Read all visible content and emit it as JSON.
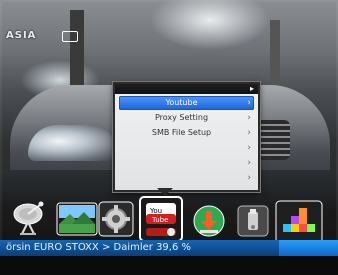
{
  "overlay": {
    "channel_tag": "ASIA"
  },
  "menu": {
    "top_arrow": "▸",
    "items": [
      {
        "label": "Youtube",
        "selected": true,
        "chevron": "›"
      },
      {
        "label": "Proxy Setting",
        "selected": false,
        "chevron": "›"
      },
      {
        "label": "SMB File Setup",
        "selected": false,
        "chevron": "›"
      },
      {
        "label": "",
        "selected": false,
        "chevron": "›"
      },
      {
        "label": "",
        "selected": false,
        "chevron": "›"
      },
      {
        "label": "",
        "selected": false,
        "chevron": "›"
      }
    ]
  },
  "dock": {
    "items": [
      {
        "name": "satellite-dish-icon"
      },
      {
        "name": "landscape-icon"
      },
      {
        "name": "gear-icon"
      },
      {
        "name": "youtube-icon",
        "logo_text_1": "You",
        "logo_text_2": "Tube"
      },
      {
        "name": "download-icon"
      },
      {
        "name": "usb-icon"
      },
      {
        "name": "blocks-game-icon"
      }
    ]
  },
  "ticker": {
    "text": "örsin   EURO STOXX > Daimler  39,6    %"
  },
  "colors": {
    "menu_selected_start": "#4c97ff",
    "menu_selected_end": "#1e63d6",
    "ticker_bg": "#1565b5",
    "youtube_red": "#d21f1f"
  }
}
